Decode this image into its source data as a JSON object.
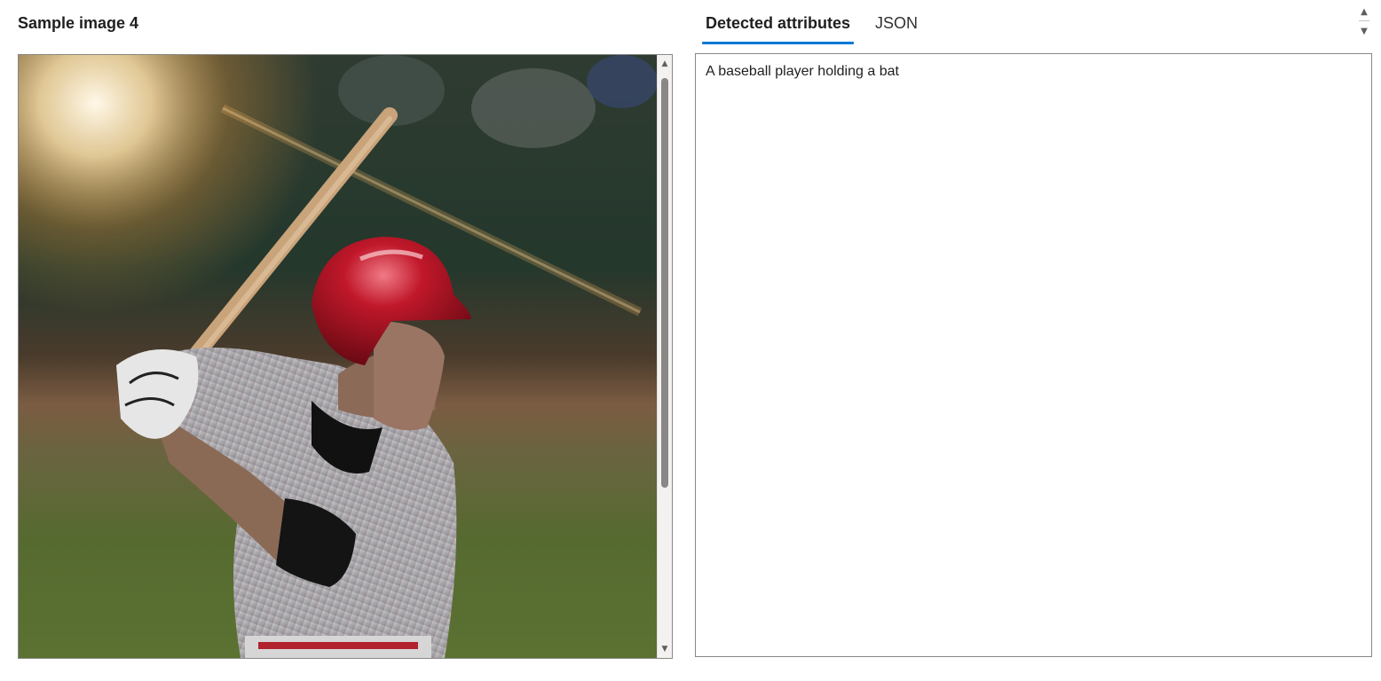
{
  "sample": {
    "title": "Sample image 4"
  },
  "tabs": [
    {
      "label": "Detected attributes",
      "active": true
    },
    {
      "label": "JSON",
      "active": false
    }
  ],
  "result": {
    "caption": "A baseball player holding a bat"
  },
  "icons": {
    "scroll_up": "triangle-up-icon",
    "scroll_down": "triangle-down-icon"
  },
  "colors": {
    "accent": "#0078d4",
    "border": "#8a8886"
  }
}
